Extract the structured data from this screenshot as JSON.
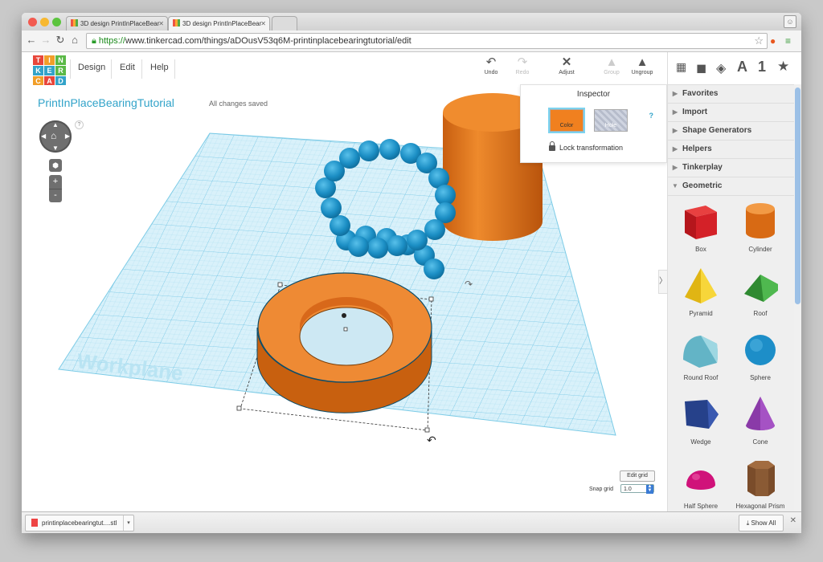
{
  "browser": {
    "tabs": [
      {
        "title": "3D design PrintInPlaceBear"
      },
      {
        "title": "3D design PrintInPlaceBear"
      }
    ],
    "url_scheme": "https://",
    "url_rest": "www.tinkercad.com/things/aDOusV53q6M-printinplacebearingtutorial/edit"
  },
  "app": {
    "logo_letters": [
      "T",
      "I",
      "N",
      "K",
      "E",
      "R",
      "C",
      "A",
      "D"
    ],
    "logo_colors": [
      "#e8463a",
      "#f19e29",
      "#5bb947",
      "#33a3c9",
      "#33a3c9",
      "#5bb947",
      "#f19e29",
      "#e8463a",
      "#33a3c9"
    ],
    "menu": [
      "Design",
      "Edit",
      "Help"
    ],
    "tools": [
      {
        "label": "Undo",
        "icon": "↶",
        "enabled": true
      },
      {
        "label": "Redo",
        "icon": "↷",
        "enabled": false
      },
      {
        "label": "Adjust",
        "icon": "✕",
        "enabled": true
      },
      {
        "label": "Group",
        "icon": "▲",
        "enabled": false
      },
      {
        "label": "Ungroup",
        "icon": "▲",
        "enabled": true
      }
    ],
    "design_name": "PrintInPlaceBearingTutorial",
    "save_status": "All changes saved"
  },
  "inspector": {
    "title": "Inspector",
    "help": "?",
    "color_label": "Color",
    "hole_label": "Hole",
    "lock_label": "Lock transformation",
    "selected_color": "#f0801f"
  },
  "viewport": {
    "workplane_label": "Workplane",
    "nav_help": "?",
    "zoom_in": "+",
    "zoom_out": "-",
    "edit_grid": "Edit grid",
    "snap_grid_label": "Snap grid",
    "snap_grid_value": "1.0"
  },
  "panel": {
    "tools": [
      "grid-icon",
      "box-icon",
      "texture-icon",
      "A",
      "1",
      "★"
    ],
    "categories": [
      {
        "label": "Favorites",
        "expanded": false
      },
      {
        "label": "Import",
        "expanded": false
      },
      {
        "label": "Shape Generators",
        "expanded": false
      },
      {
        "label": "Helpers",
        "expanded": false
      },
      {
        "label": "Tinkerplay",
        "expanded": false
      },
      {
        "label": "Geometric",
        "expanded": true
      }
    ],
    "shapes": [
      {
        "name": "Box",
        "color": "#d42128"
      },
      {
        "name": "Cylinder",
        "color": "#e8781f"
      },
      {
        "name": "Pyramid",
        "color": "#f4c81d"
      },
      {
        "name": "Roof",
        "color": "#3aa03c"
      },
      {
        "name": "Round Roof",
        "color": "#6dbfcf"
      },
      {
        "name": "Sphere",
        "color": "#1d8ec8"
      },
      {
        "name": "Wedge",
        "color": "#26418a"
      },
      {
        "name": "Cone",
        "color": "#8a3aa8"
      },
      {
        "name": "Half Sphere",
        "color": "#d0127a"
      },
      {
        "name": "Hexagonal Prism",
        "color": "#8a5a34"
      }
    ]
  },
  "downloads": {
    "file": "printinplacebearingtut....stl",
    "show_all": "Show All"
  }
}
